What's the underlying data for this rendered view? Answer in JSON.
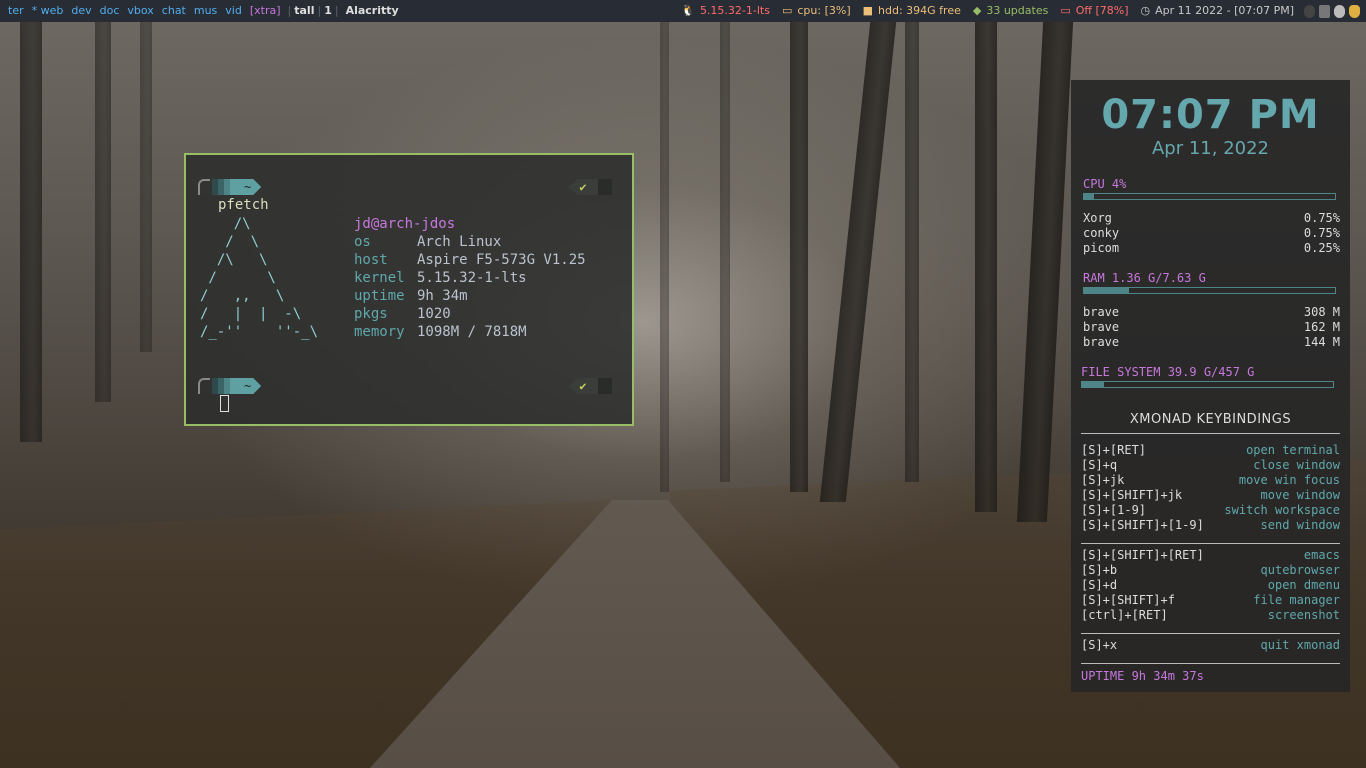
{
  "bar": {
    "workspaces": [
      "ter",
      "* web",
      "dev",
      "doc",
      "vbox",
      "chat",
      "mus",
      "vid",
      "[xtra]"
    ],
    "layout": "tall",
    "window_count": "1",
    "window_title": "Alacritty",
    "kernel": "5.15.32-1-lts",
    "cpu": "cpu: [3%]",
    "hdd": "hdd: 394G free",
    "updates": "33 updates",
    "battery": "Off [78%]",
    "datetime": "Apr 11 2022 - [07:07 PM]",
    "colors": {
      "bar_bg": "#282c34",
      "workspace": "#51afef",
      "accent": "#c678dd"
    }
  },
  "terminal": {
    "prompt_symbol": "~",
    "status_symbol": "✔",
    "command": "pfetch",
    "ascii_logo": "    /\\\n   /  \\\n  /\\   \\\n /      \\\n/   ,,   \\\n/   |  |  -\\\n/_-''    ''-_\\",
    "user_host": "jd@arch-jdos",
    "info": [
      {
        "key": "os",
        "value": "Arch Linux"
      },
      {
        "key": "host",
        "value": "Aspire F5-573G V1.25"
      },
      {
        "key": "kernel",
        "value": "5.15.32-1-lts"
      },
      {
        "key": "uptime",
        "value": "9h 34m"
      },
      {
        "key": "pkgs",
        "value": "1020"
      },
      {
        "key": "memory",
        "value": "1098M / 7818M"
      }
    ]
  },
  "conky": {
    "time": "07:07 PM",
    "date": "Apr 11, 2022",
    "cpu_label": "CPU  4%",
    "cpu_fraction": 0.04,
    "cpu_procs": [
      {
        "name": "Xorg",
        "value": "0.75%"
      },
      {
        "name": "conky",
        "value": "0.75%"
      },
      {
        "name": "picom",
        "value": "0.25%"
      }
    ],
    "ram_label": "RAM  1.36 G/7.63 G",
    "ram_fraction": 0.178,
    "mem_procs": [
      {
        "name": "brave",
        "value": "308 M"
      },
      {
        "name": "brave",
        "value": "162 M"
      },
      {
        "name": "brave",
        "value": "144 M"
      }
    ],
    "fs_label": "FILE SYSTEM 39.9 G/457 G",
    "fs_fraction": 0.087,
    "keybindings_title": "XMONAD KEYBINDINGS",
    "keybindings_group1": [
      {
        "key": "[S]+[RET]",
        "action": "open terminal"
      },
      {
        "key": "[S]+q",
        "action": "close window"
      },
      {
        "key": "[S]+jk",
        "action": "move win focus"
      },
      {
        "key": "[S]+[SHIFT]+jk",
        "action": "move window"
      },
      {
        "key": "[S]+[1-9]",
        "action": "switch workspace"
      },
      {
        "key": "[S]+[SHIFT]+[1-9]",
        "action": "send window"
      }
    ],
    "keybindings_group2": [
      {
        "key": "[S]+[SHIFT]+[RET]",
        "action": "emacs"
      },
      {
        "key": "[S]+b",
        "action": "qutebrowser"
      },
      {
        "key": "[S]+d",
        "action": "open dmenu"
      },
      {
        "key": "[S]+[SHIFT]+f",
        "action": "file manager"
      },
      {
        "key": "[ctrl]+[RET]",
        "action": "screenshot"
      }
    ],
    "keybindings_group3": [
      {
        "key": "[S]+x",
        "action": "quit xmonad"
      }
    ],
    "uptime": "UPTIME  9h 34m 37s"
  }
}
